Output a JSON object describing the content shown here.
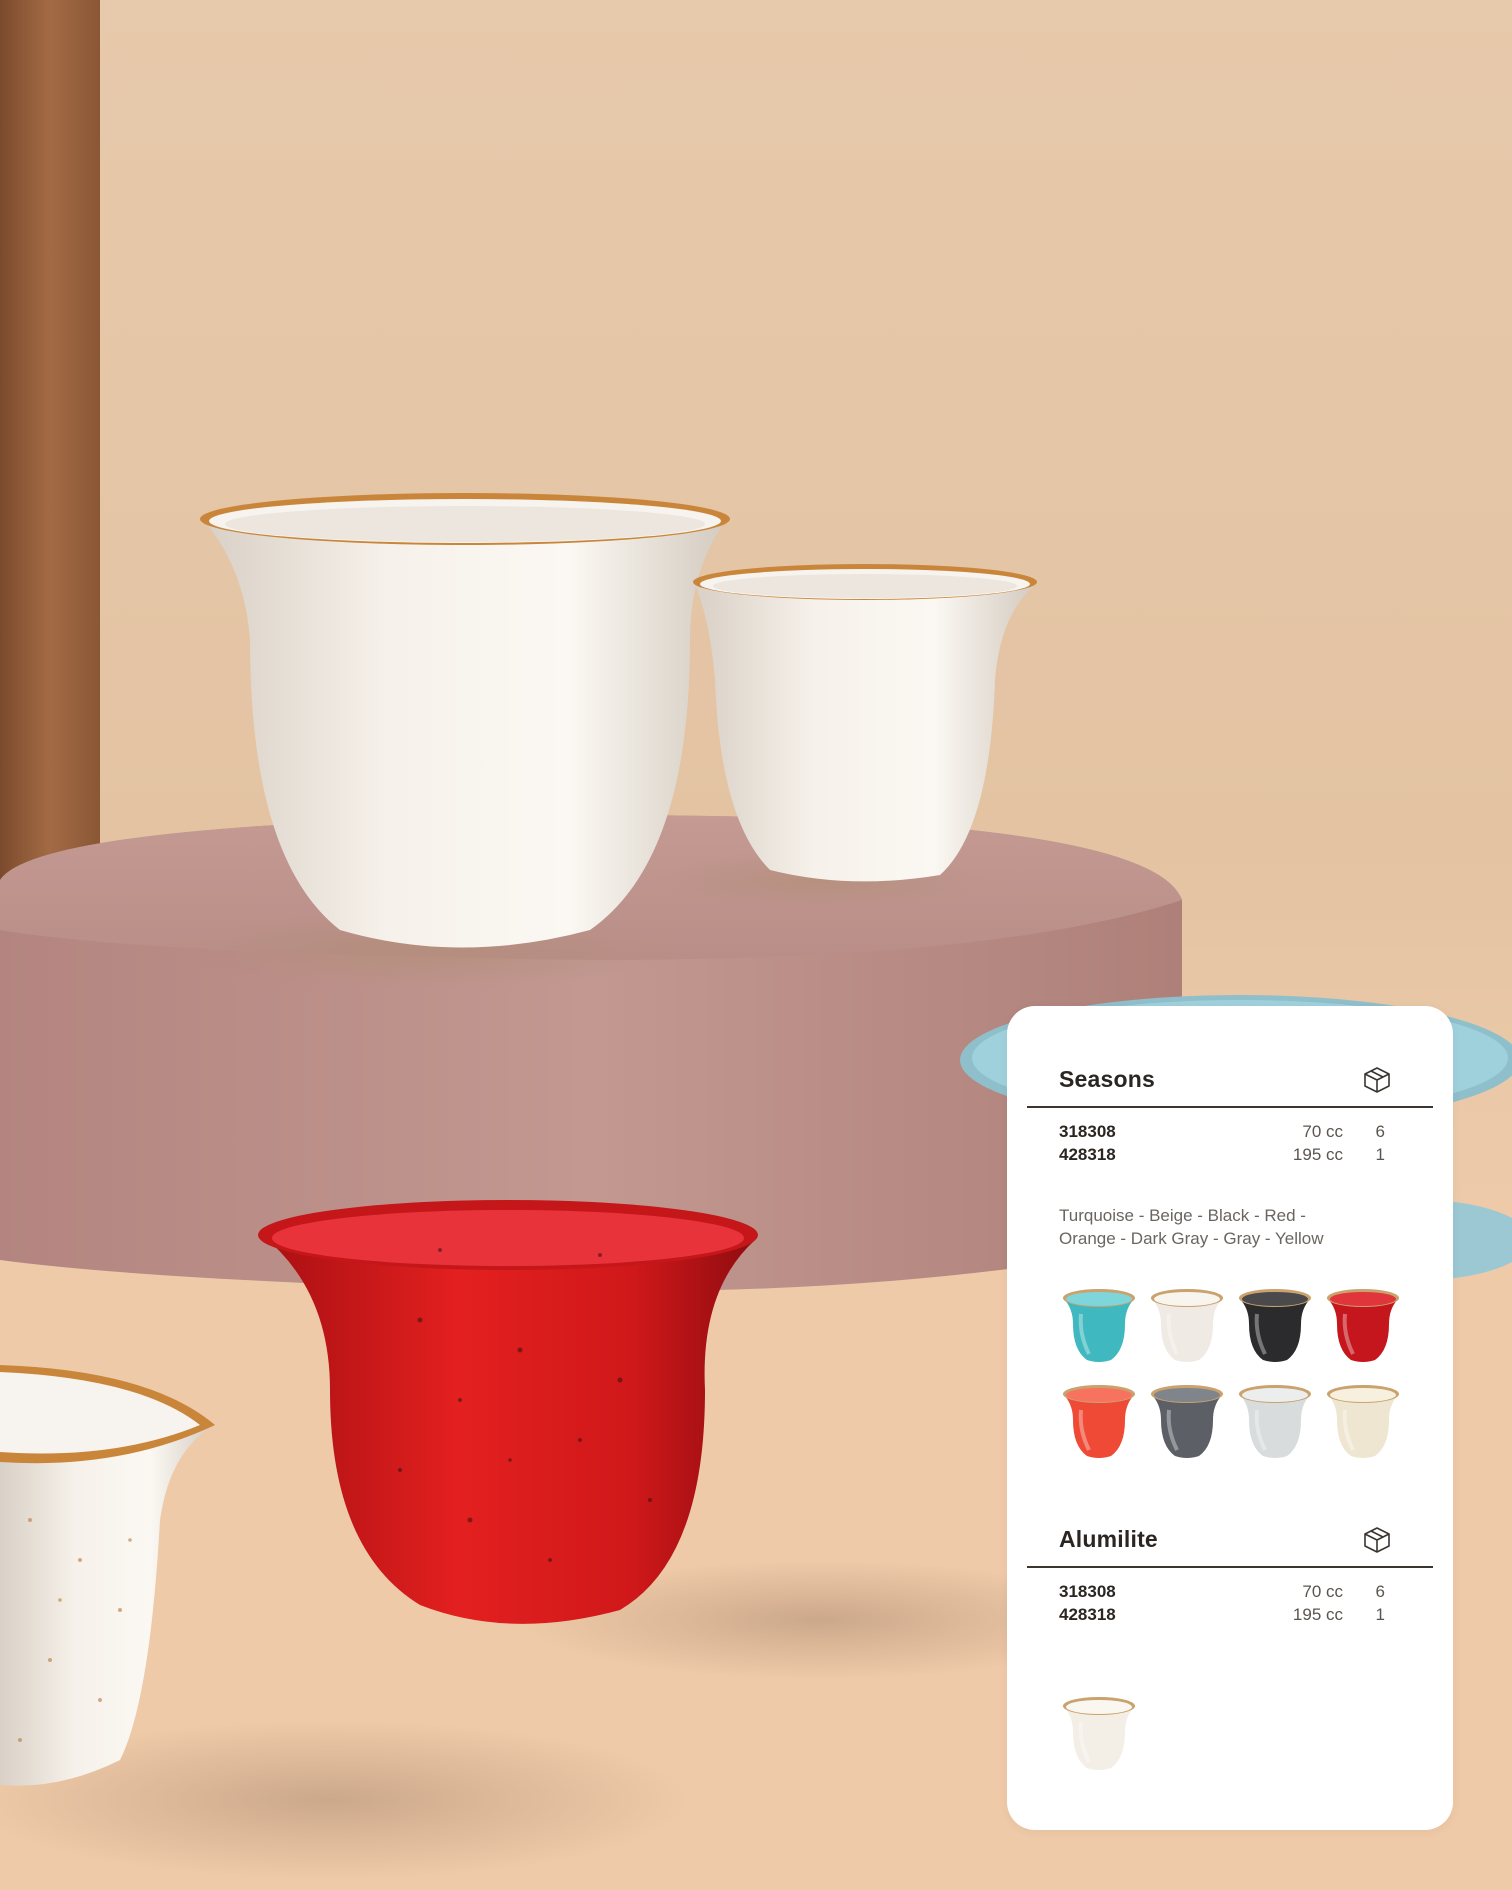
{
  "seasons": {
    "title": "Seasons",
    "box_icon": "box-icon",
    "rows": [
      {
        "code": "318308",
        "volume": "70 cc",
        "qty": "6"
      },
      {
        "code": "428318",
        "volume": "195 cc",
        "qty": "1"
      }
    ],
    "colors_line1": "Turquoise - Beige - Black - Red -",
    "colors_line2": "Orange - Dark Gray - Gray - Yellow",
    "swatches": [
      {
        "name": "turquoise-cup",
        "body": "#3fb8bf",
        "inner": "#7fd6da"
      },
      {
        "name": "beige-cup",
        "body": "#efeae4",
        "inner": "#f8f4ee"
      },
      {
        "name": "black-cup",
        "body": "#2b2b2d",
        "inner": "#4a4a4c"
      },
      {
        "name": "red-cup",
        "body": "#c4161c",
        "inner": "#e0353a"
      },
      {
        "name": "orange-cup",
        "body": "#ee4a35",
        "inner": "#f7735f"
      },
      {
        "name": "dark-gray-cup",
        "body": "#5c6066",
        "inner": "#80858b"
      },
      {
        "name": "gray-cup",
        "body": "#d8dcdc",
        "inner": "#eceeee"
      },
      {
        "name": "yellow-cup",
        "body": "#efe6d2",
        "inner": "#f7f0de"
      }
    ]
  },
  "alumilite": {
    "title": "Alumilite",
    "box_icon": "box-icon",
    "rows": [
      {
        "code": "318308",
        "volume": "70 cc",
        "qty": "6"
      },
      {
        "code": "428318",
        "volume": "195 cc",
        "qty": "1"
      }
    ],
    "swatches": [
      {
        "name": "cream-cup",
        "body": "#f3efe6",
        "inner": "#faf7f0"
      }
    ]
  }
}
